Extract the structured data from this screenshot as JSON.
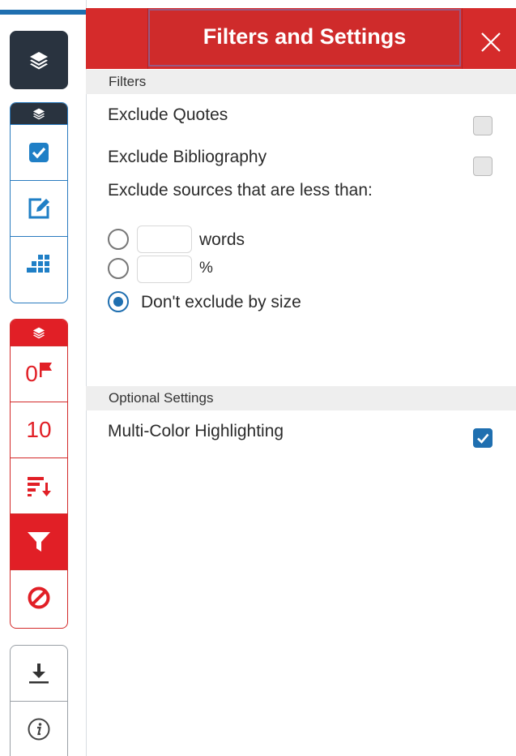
{
  "header": {
    "title": "Filters and Settings",
    "close_icon": "close-icon"
  },
  "rail": {
    "colors": {
      "blue": "#2a7bbf",
      "red": "#e11f26",
      "dark": "#29333f"
    },
    "flag_count": "0",
    "match_count": "10"
  },
  "filters": {
    "section_title": "Filters",
    "exclude_quotes": {
      "label": "Exclude Quotes",
      "checked": false
    },
    "exclude_bibliography": {
      "label": "Exclude Bibliography",
      "checked": false
    },
    "exclude_size_label": "Exclude sources that are less than:",
    "words": {
      "label": "words",
      "value": "",
      "selected": false
    },
    "percent": {
      "label": "%",
      "value": "",
      "selected": false
    },
    "no_size": {
      "label": "Don't exclude by size",
      "selected": true
    }
  },
  "optional": {
    "section_title": "Optional Settings",
    "multi_color": {
      "label": "Multi-Color Highlighting",
      "checked": true
    }
  }
}
